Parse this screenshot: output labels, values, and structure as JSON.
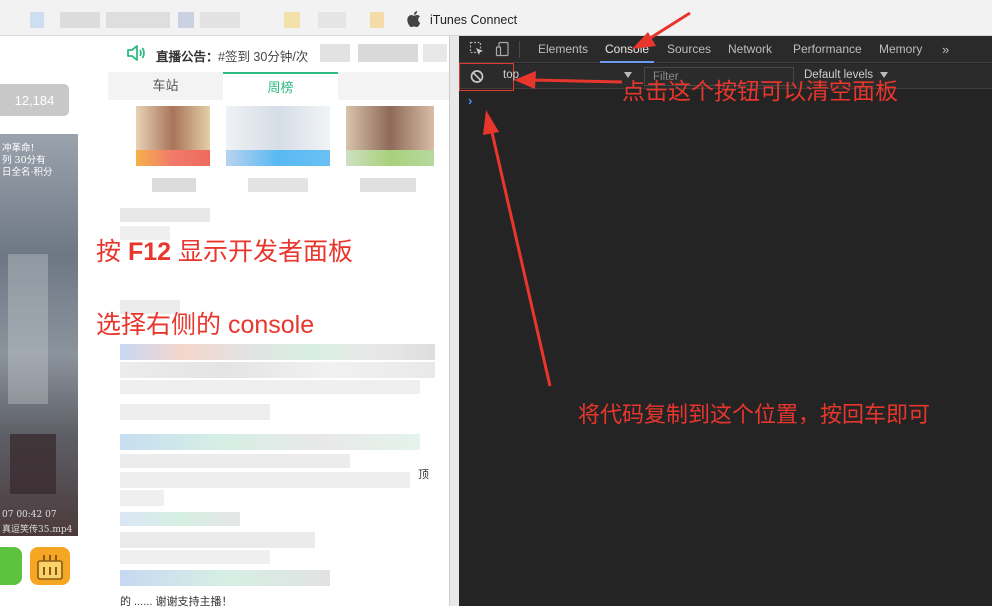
{
  "browser": {
    "bookmark_label": "iTunes Connect"
  },
  "left_page": {
    "counter": "12,184",
    "video_lines": [
      "冲革命!",
      "列 30分有",
      "日全名·积分"
    ],
    "video_timestamp": "07 00:42 07",
    "video_filename": "真逗笑传35.mp4"
  },
  "main": {
    "notice_label": "直播公告：",
    "notice_text": "#签到 30分钟/次",
    "tabs": [
      {
        "label": "车站",
        "active": false
      },
      {
        "label": "周榜",
        "active": true
      }
    ],
    "top_text": "顶",
    "bottom_text": "的 ...... 谢谢支持主播！"
  },
  "annotations": {
    "press_prefix": "按 ",
    "press_key": "F12",
    "press_suffix": " 显示开发者面板",
    "select_prefix": "选择右侧的 ",
    "select_word": "console",
    "clear_hint": "点击这个按钮可以清空面板",
    "paste_hint": "将代码复制到这个位置，按回车即可"
  },
  "devtools": {
    "tabs": [
      "Elements",
      "Console",
      "Sources",
      "Network",
      "Performance",
      "Memory"
    ],
    "active_tab": "Console",
    "more": "»",
    "context": "top",
    "filter_placeholder": "Filter",
    "levels": "Default levels",
    "prompt": "›"
  },
  "colors": {
    "annotation_red": "#e8362d",
    "accent_green": "#2dbb82",
    "devtools_bg": "#242424",
    "console_prompt_blue": "#4d8ff2"
  }
}
